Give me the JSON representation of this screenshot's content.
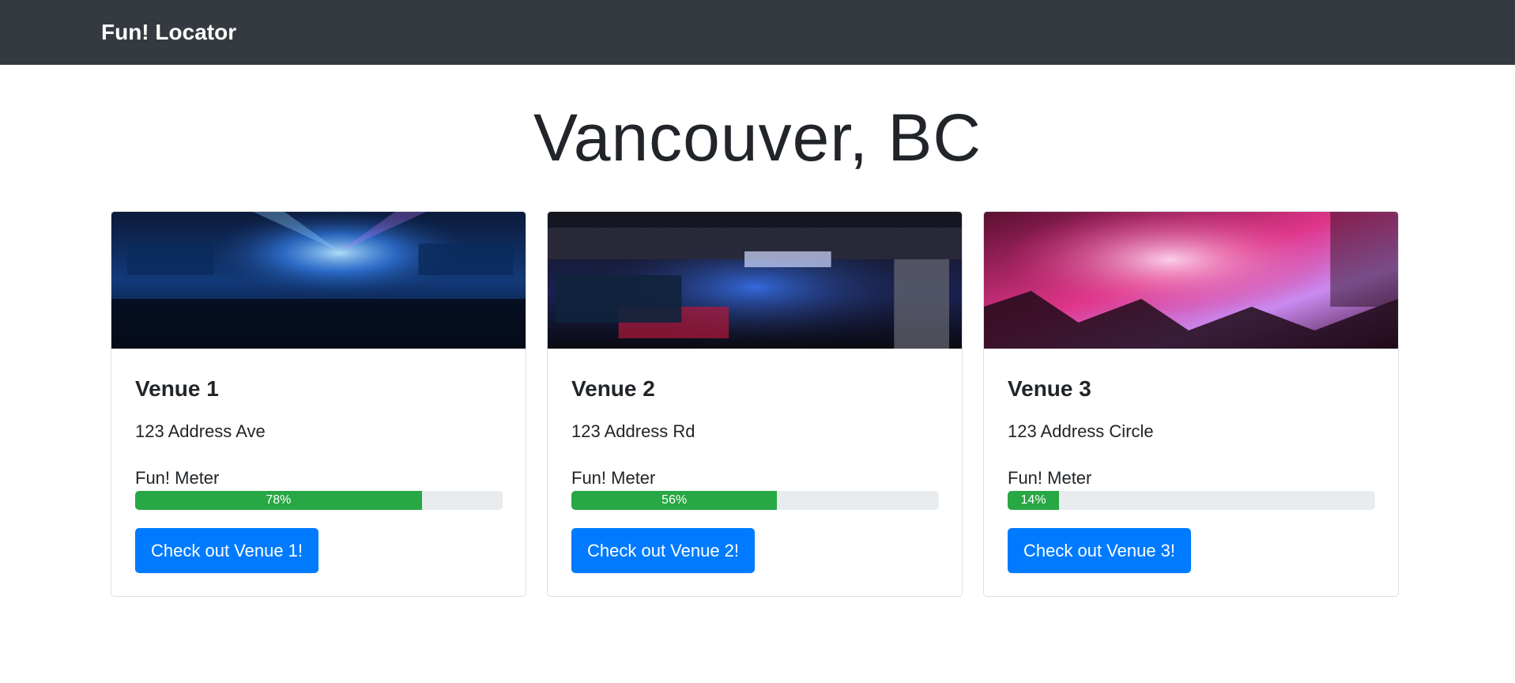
{
  "navbar": {
    "brand": "Fun! Locator"
  },
  "page": {
    "title": "Vancouver, BC"
  },
  "colors": {
    "navbar_bg": "#343a40",
    "progress_fill": "#28a745",
    "progress_track": "#e9ecef",
    "button_primary": "#007bff"
  },
  "venues": [
    {
      "name": "Venue 1",
      "address": "123 Address Ave",
      "meter_label": "Fun! Meter",
      "fun_percent": 78,
      "fun_label": "78%",
      "button_label": "Check out Venue 1!"
    },
    {
      "name": "Venue 2",
      "address": "123 Address Rd",
      "meter_label": "Fun! Meter",
      "fun_percent": 56,
      "fun_label": "56%",
      "button_label": "Check out Venue 2!"
    },
    {
      "name": "Venue 3",
      "address": "123 Address Circle",
      "meter_label": "Fun! Meter",
      "fun_percent": 14,
      "fun_label": "14%",
      "button_label": "Check out Venue 3!"
    }
  ]
}
